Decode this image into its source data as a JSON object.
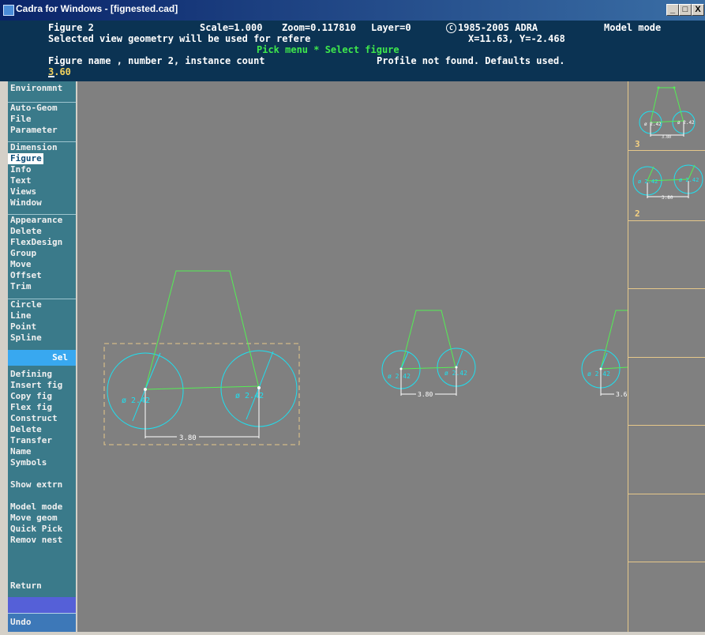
{
  "window": {
    "title": "Cadra for Windows - [fignested.cad]",
    "buttons": {
      "minimize": "_",
      "maximize": "□",
      "close": "X"
    }
  },
  "status": {
    "figure_label": "Figure 2",
    "scale": "Scale=1.000",
    "zoom": "Zoom=0.117810",
    "layer": "Layer=0",
    "copyright": "1985-2005 ADRA",
    "mode": "Model mode",
    "line2": "Selected view geometry will be used for refere",
    "coords": "X=11.63, Y=-2.468",
    "prompt": "Pick menu * Select figure",
    "line4": "Figure name , number 2, instance count",
    "profile": "Profile not found. Defaults used.",
    "input_value": "3.60"
  },
  "menu": {
    "environment": "Environmnt",
    "group1": [
      "Auto-Geom",
      "File",
      "Parameter"
    ],
    "group2": [
      "Dimension",
      "Figure",
      "Info",
      "Text",
      "Views",
      "Window"
    ],
    "group3": [
      "Appearance",
      "Delete",
      "FlexDesign",
      "Group",
      "Move",
      "Offset",
      "Trim"
    ],
    "group4": [
      "Circle",
      "Line",
      "Point",
      "Spline"
    ],
    "sel": "Sel",
    "lower1": [
      "Defining",
      "Insert fig",
      "Copy fig",
      "Flex fig",
      "Construct",
      "Delete",
      "Transfer",
      "Name",
      "Symbols"
    ],
    "show_extrn": "Show extrn",
    "lower2": [
      "Model mode",
      "Move geom",
      "Quick Pick",
      "Remov nest"
    ],
    "return": "Return",
    "undo": "Undo"
  },
  "drawing": {
    "diameter_label": "ø 2.42",
    "dimension_label": "3.80",
    "partial_dimension_label": "3.6"
  },
  "thumbnails": [
    {
      "number": "3",
      "diameter_label": "ø 2.42",
      "dimension_label": "3.80"
    },
    {
      "number": "2",
      "diameter_label": "ø 2.42",
      "dimension_label": "3.80"
    }
  ],
  "colors": {
    "header_bg": "#0b3353",
    "menu_bg": "#3a7a8a",
    "canvas_bg": "#808080",
    "geometry_cyan": "#1ee0f0",
    "geometry_green": "#54ee54",
    "selection_box": "#e6c88a",
    "prompt_green": "#3ee84c",
    "input_yellow": "#f2d25e"
  }
}
